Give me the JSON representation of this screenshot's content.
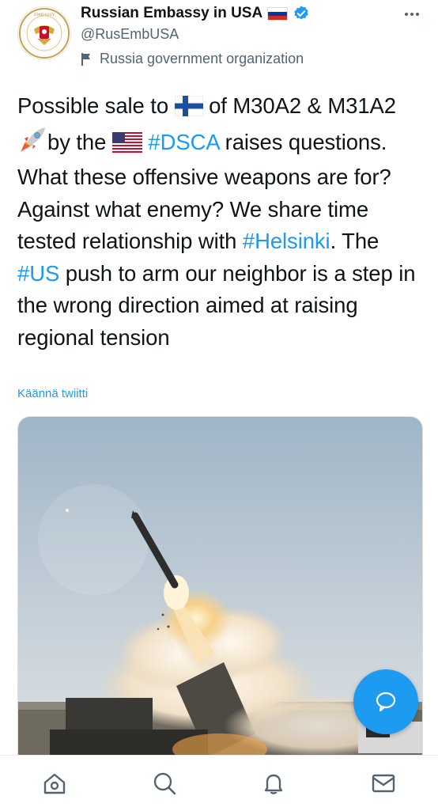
{
  "profile": {
    "display_name": "Russian Embassy in USA",
    "handle": "@RusEmbUSA",
    "gov_label": "Russia government organization",
    "verified": true
  },
  "tweet": {
    "seg1": "Possible sale to ",
    "seg2": " of M30A2 & M31A2 ",
    "seg3": "by the ",
    "hashtag_dsca": "#DSCA",
    "seg4": " raises questions. What these offensive weapons are for? Against what enemy? We share time tested relationship with ",
    "hashtag_helsinki": "#Helsinki",
    "seg5": ". The ",
    "hashtag_us": "#US",
    "seg6": " push to arm our neighbor is a step in the wrong direction aimed at raising regional tension",
    "translate_label": "Käännä twiitti"
  },
  "colors": {
    "accent": "#1d9bf0",
    "text": "#0f1419",
    "secondary": "#536471"
  },
  "icons": {
    "more": "more-icon",
    "flag": "flag-icon",
    "compose": "compose-icon",
    "home": "home-icon",
    "search": "search-icon",
    "notifications": "bell-icon",
    "messages": "mail-icon"
  }
}
